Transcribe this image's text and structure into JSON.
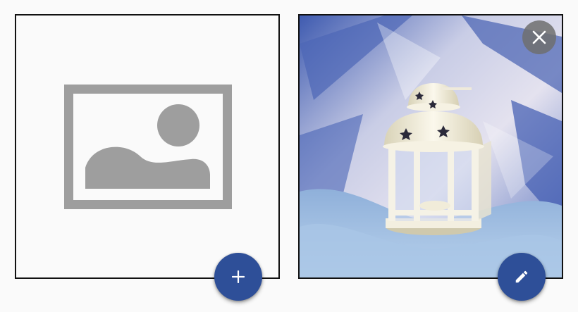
{
  "colors": {
    "fab_background": "#2e4f98",
    "placeholder_gray": "#9e9e9e",
    "card_border": "#111111",
    "close_button_bg": "#6e6e6e"
  },
  "cards": [
    {
      "kind": "empty",
      "icon": "image-placeholder-icon",
      "action_icon": "plus-icon"
    },
    {
      "kind": "photo",
      "icon": "photo",
      "remove_icon": "close-icon",
      "action_icon": "pencil-icon"
    }
  ]
}
